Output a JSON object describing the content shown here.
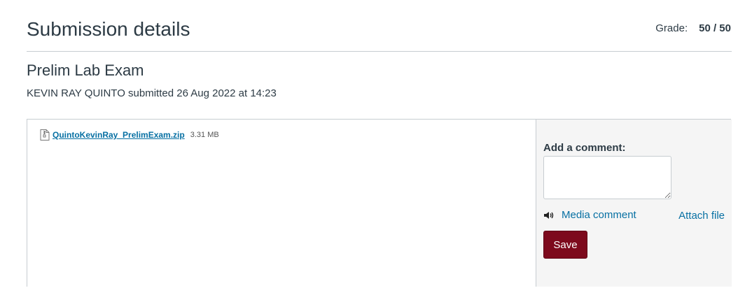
{
  "header": {
    "title": "Submission details",
    "grade_label": "Grade:",
    "grade_value": "50 / 50"
  },
  "assignment": {
    "title": "Prelim Lab Exam",
    "submitted_text": "KEVIN RAY QUINTO submitted 26 Aug 2022 at 14:23"
  },
  "files": [
    {
      "name": "QuintoKevinRay_PrelimExam.zip",
      "size": "3.31 MB",
      "icon": "zip-file-icon"
    }
  ],
  "comment": {
    "label": "Add a comment:",
    "textarea_value": "",
    "media_comment_label": "Media comment",
    "media_icon": "speaker-icon",
    "attach_file_label": "Attach file",
    "save_label": "Save"
  },
  "colors": {
    "text": "#2d3b45",
    "link": "#0770a3",
    "save_button": "#7d0a1d",
    "comment_panel_bg": "#f5f5f5",
    "border": "#c7cdd1"
  }
}
